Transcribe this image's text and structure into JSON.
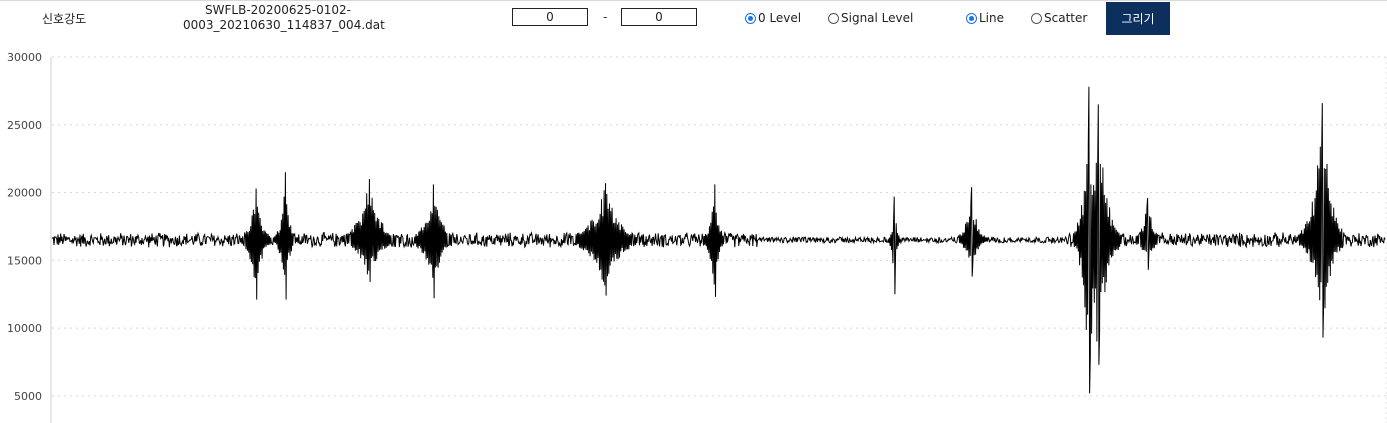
{
  "header": {
    "title": "신호강도",
    "filename_line1": "SWFLB-20200625-0102-",
    "filename_line2": "0003_20210630_114837_004.dat",
    "range_from": "0",
    "range_sep": "-",
    "range_to": "0",
    "level_options": [
      "0 Level",
      "Signal Level"
    ],
    "level_selected": "0 Level",
    "type_options": [
      "Line",
      "Scatter"
    ],
    "type_selected": "Line",
    "draw_button": "그리기",
    "accent_color": "#1a73e8",
    "button_color": "#0d2f5e"
  },
  "chart_data": {
    "type": "line",
    "title": "",
    "xlabel": "",
    "ylabel": "",
    "ylim": [
      3000,
      30000
    ],
    "yticks": [
      30000,
      25000,
      20000,
      15000,
      10000,
      5000
    ],
    "grid": true,
    "line_color": "#000000",
    "baseline": 16500,
    "noise_amplitude": 600,
    "samples": 2000,
    "bursts": [
      {
        "x": 0.153,
        "high": 20300,
        "low": 12100,
        "width": 0.004
      },
      {
        "x": 0.175,
        "high": 21500,
        "low": 12100,
        "width": 0.003
      },
      {
        "x": 0.238,
        "high": 21000,
        "low": 13400,
        "width": 0.008
      },
      {
        "x": 0.286,
        "high": 20600,
        "low": 12200,
        "width": 0.006
      },
      {
        "x": 0.415,
        "high": 20700,
        "low": 12400,
        "width": 0.01
      },
      {
        "x": 0.497,
        "high": 20600,
        "low": 12300,
        "width": 0.003
      },
      {
        "x": 0.632,
        "high": 19700,
        "low": 12500,
        "width": 0.0015
      },
      {
        "x": 0.69,
        "high": 20400,
        "low": 13800,
        "width": 0.004
      },
      {
        "x": 0.778,
        "high": 27800,
        "low": 5200,
        "width": 0.004
      },
      {
        "x": 0.785,
        "high": 26500,
        "low": 7300,
        "width": 0.006
      },
      {
        "x": 0.822,
        "high": 19600,
        "low": 14300,
        "width": 0.004
      },
      {
        "x": 0.953,
        "high": 26600,
        "low": 9300,
        "width": 0.006
      }
    ]
  }
}
